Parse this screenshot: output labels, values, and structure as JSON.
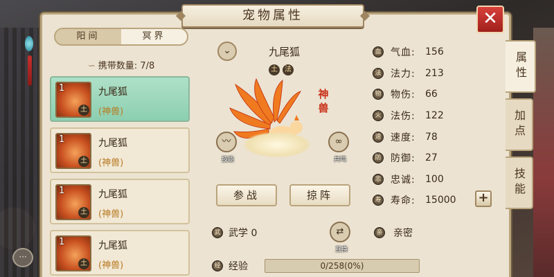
{
  "title": "宠物属性",
  "close_glyph": "✕",
  "realm_tabs": [
    {
      "label": "阳间",
      "active": true
    },
    {
      "label": "冥界",
      "active": false
    }
  ],
  "carry": {
    "label": "携带数量:",
    "value": "7/8"
  },
  "pet_list": [
    {
      "level": "1",
      "element": "土",
      "name": "九尾狐",
      "type": "(神兽)",
      "selected": true
    },
    {
      "level": "1",
      "element": "土",
      "name": "九尾狐",
      "type": "(神兽)",
      "selected": false
    },
    {
      "level": "1",
      "element": "土",
      "name": "九尾狐",
      "type": "(神兽)",
      "selected": false
    },
    {
      "level": "1",
      "element": "土",
      "name": "九尾狐",
      "type": "(神兽)",
      "selected": false
    }
  ],
  "detail": {
    "name": "九尾狐",
    "elements": [
      "土",
      "法"
    ],
    "rarity_tag": "神兽",
    "left_action_icon": "〰",
    "right_action_icon": "∞",
    "left_action_caption": "技能",
    "right_action_caption": "共鸣",
    "fight_button": "参战",
    "formation_button": "掠阵",
    "wuxue": "武学 0",
    "swap_icon": "⇄",
    "swap_caption": "互换",
    "qinmi": "亲密",
    "exp_label": "经验",
    "exp_text": "0/258(0%)",
    "exp_fraction": 0
  },
  "stats": [
    {
      "icon": "血",
      "label": "气血:",
      "value": "156"
    },
    {
      "icon": "法",
      "label": "法力:",
      "value": "213"
    },
    {
      "icon": "物",
      "label": "物伤:",
      "value": "66"
    },
    {
      "icon": "火",
      "label": "法伤:",
      "value": "122"
    },
    {
      "icon": "速",
      "label": "速度:",
      "value": "78"
    },
    {
      "icon": "防",
      "label": "防御:",
      "value": "27"
    },
    {
      "icon": "忠",
      "label": "忠诚:",
      "value": "100"
    },
    {
      "icon": "寿",
      "label": "寿命:",
      "value": "15000"
    }
  ],
  "plus_glyph": "+",
  "side_tabs": [
    {
      "label": "属性",
      "active": true
    },
    {
      "label": "加点",
      "active": false
    },
    {
      "label": "技能",
      "active": false
    }
  ],
  "chat_glyph": "···",
  "colors": {
    "accent": "#b9a47c",
    "selected": "#aee0c8",
    "rarity": "#c83018",
    "close": "#d8403a"
  }
}
